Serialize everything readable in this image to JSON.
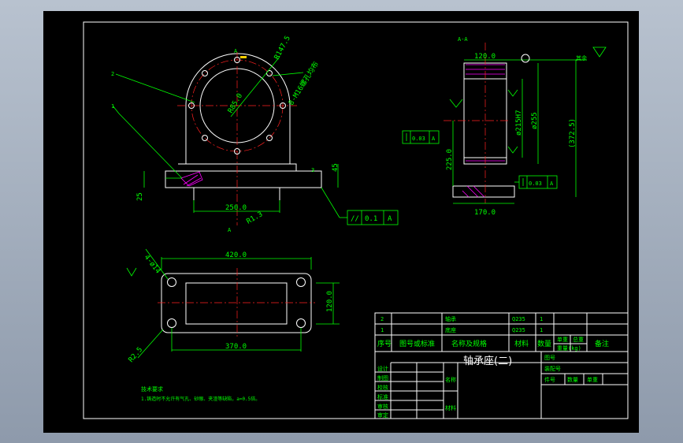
{
  "colors": {
    "background": "#000000",
    "outline": "#ffffff",
    "dimension": "#00ff00",
    "centerline": "#ff2020",
    "hatch": "#ff00ff"
  },
  "front_view": {
    "label_2": "2",
    "label_1": "1",
    "radius_r147": "R147.5",
    "radius_r85": "R85.0",
    "holes_note": "8-M16螺孔均布",
    "dim_250": "250.0",
    "dim_25": "25",
    "dim_45": "45",
    "dim_3": "3",
    "radius_r1_3": "R1.3",
    "section_a_top": "A",
    "section_a_bottom": "A",
    "parallel_sym": "//",
    "parallel_tol": "0.1",
    "parallel_ref": "A"
  },
  "section_view": {
    "title": "A-A",
    "rest_note": "其余",
    "dim_120": "120.0",
    "dim_170": "170.0",
    "dim_225": "225.0",
    "dim_215": "ø215H7",
    "dim_255": "ø255",
    "dim_372": "(372.5)",
    "perp_tol_1": "0.03",
    "perp_ref_1": "A",
    "perp_tol_2": "0.03",
    "perp_ref_2": "A"
  },
  "top_view": {
    "holes": "4-ø14",
    "dim_420": "420.0",
    "dim_370": "370.0",
    "dim_120": "120.0",
    "radius": "R2.5"
  },
  "notes": {
    "title": "技术要求",
    "line1": "1.铸造时不允许有气孔、砂眼、夹渣等缺陷，a=0.5倍。"
  },
  "title_block": {
    "parts": [
      {
        "no": "2",
        "name": "轴承",
        "material": "Q235",
        "qty": "1"
      },
      {
        "no": "1",
        "name": "底座",
        "material": "Q235",
        "qty": "1"
      }
    ],
    "header": {
      "no": "序号",
      "std": "图号或标准",
      "name": "名称及规格",
      "material": "材料",
      "qty": "数量",
      "unit_weight": "单重",
      "total_weight": "总重",
      "weight_unit": "重量(kg)",
      "remark": "备注"
    },
    "drawing_title": "轴承座(二)",
    "fig_no_label": "图号",
    "assembly_label": "装配号",
    "row_labels": [
      "设计",
      "制图",
      "校核",
      "标准",
      "审核",
      "审定"
    ],
    "name_label": "名称",
    "material_label": "材料",
    "bottom_labels": [
      "件号",
      "数量",
      "单重"
    ]
  }
}
